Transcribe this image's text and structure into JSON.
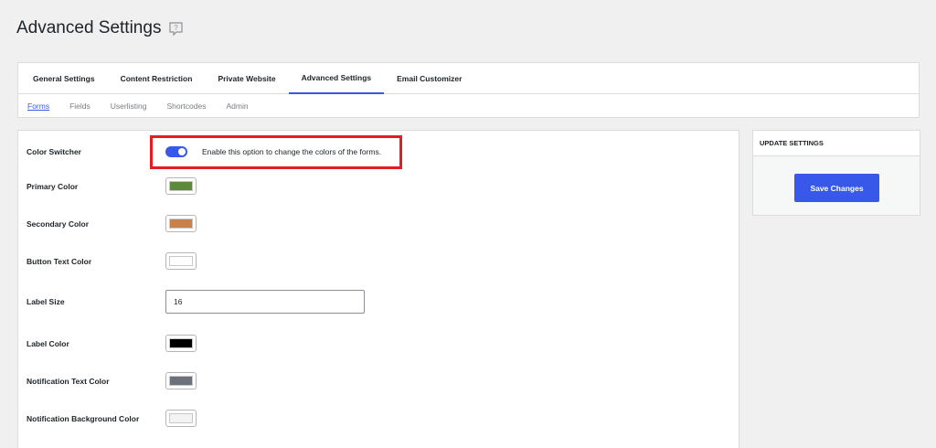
{
  "page": {
    "title": "Advanced Settings"
  },
  "main_tabs": [
    {
      "label": "General Settings"
    },
    {
      "label": "Content Restriction"
    },
    {
      "label": "Private Website"
    },
    {
      "label": "Advanced Settings",
      "active": true
    },
    {
      "label": "Email Customizer"
    }
  ],
  "sub_tabs": [
    {
      "label": "Forms",
      "active": true
    },
    {
      "label": "Fields"
    },
    {
      "label": "Userlisting"
    },
    {
      "label": "Shortcodes"
    },
    {
      "label": "Admin"
    }
  ],
  "settings": {
    "color_switcher": {
      "label": "Color Switcher",
      "enabled": true,
      "description": "Enable this option to change the colors of the forms."
    },
    "primary_color": {
      "label": "Primary Color",
      "value": "#5b8a3a"
    },
    "secondary_color": {
      "label": "Secondary Color",
      "value": "#c8814a"
    },
    "button_text_color": {
      "label": "Button Text Color",
      "value": "#ffffff"
    },
    "label_size": {
      "label": "Label Size",
      "value": "16"
    },
    "label_color": {
      "label": "Label Color",
      "value": "#000000"
    },
    "notification_text_color": {
      "label": "Notification Text Color",
      "value": "#6b727b"
    },
    "notification_background_color": {
      "label": "Notification Background Color",
      "value": "#f3f3f3"
    }
  },
  "sidebar": {
    "heading": "UPDATE SETTINGS",
    "save_label": "Save Changes"
  },
  "colors": {
    "accent": "#3858e9",
    "highlight": "#e51c23"
  }
}
